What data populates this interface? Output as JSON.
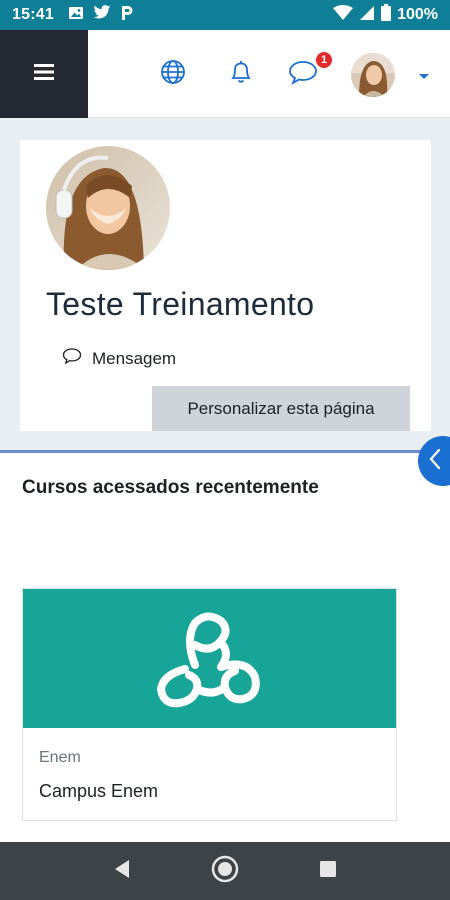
{
  "status_bar": {
    "time": "15:41",
    "battery": "100%",
    "icons": [
      "image-icon",
      "twitter-icon",
      "p-app-icon",
      "wifi-icon",
      "signal-icon",
      "battery-icon"
    ]
  },
  "navbar": {
    "icons": [
      "menu-icon",
      "globe-icon",
      "bell-icon",
      "chat-icon",
      "chevron-down-icon"
    ],
    "message_count": "1",
    "accent_color": "#1b6fd1"
  },
  "profile": {
    "name": "Teste Treinamento",
    "message_label": "Mensagem",
    "customize_label": "Personalizar esta página"
  },
  "recent_courses": {
    "title": "Cursos acessados recentemente",
    "courses": [
      {
        "category": "Enem",
        "name": "Campus Enem",
        "image_color": "#17a598"
      }
    ]
  },
  "colors": {
    "status_bar": "#0f7f97",
    "drawer_bg": "#252a32",
    "badge": "#e12b2b",
    "course_header": "#17a598"
  }
}
